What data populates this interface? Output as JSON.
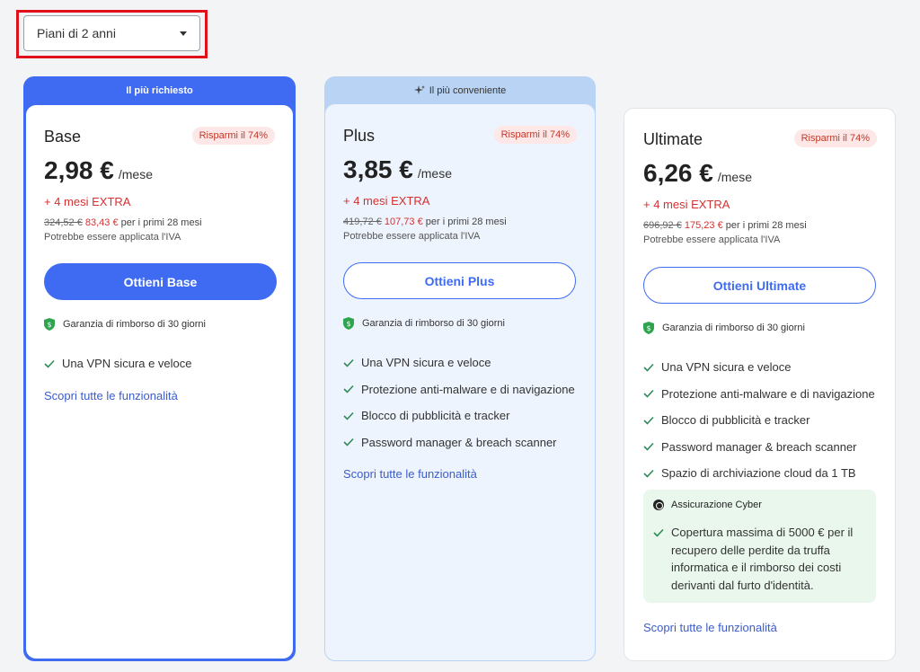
{
  "period_select": {
    "value": "Piani di 2 anni"
  },
  "plans": [
    {
      "header": "Il più richiesto",
      "name": "Base",
      "badge": "Risparmi il 74%",
      "price": "2,98 €",
      "unit": "/mese",
      "extra": "+ 4 mesi EXTRA",
      "old_total": "324,52 €",
      "new_total": "83,43 €",
      "total_suffix": "per i primi 28 mesi",
      "vat": "Potrebbe essere applicata l'IVA",
      "button": "Ottieni Base",
      "guarantee": "Garanzia di rimborso di 30 giorni",
      "features": [
        "Una VPN sicura e veloce"
      ],
      "link": "Scopri tutte le funzionalità"
    },
    {
      "header": "Il più conveniente",
      "name": "Plus",
      "badge": "Risparmi il 74%",
      "price": "3,85 €",
      "unit": "/mese",
      "extra": "+ 4 mesi EXTRA",
      "old_total": "419,72 €",
      "new_total": "107,73 €",
      "total_suffix": "per i primi 28 mesi",
      "vat": "Potrebbe essere applicata l'IVA",
      "button": "Ottieni Plus",
      "guarantee": "Garanzia di rimborso di 30 giorni",
      "features": [
        "Una VPN sicura e veloce",
        "Protezione anti-malware e di navigazione",
        "Blocco di pubblicità e tracker",
        "Password manager & breach scanner"
      ],
      "link": "Scopri tutte le funzionalità"
    },
    {
      "name": "Ultimate",
      "badge": "Risparmi il 74%",
      "price": "6,26 €",
      "unit": "/mese",
      "extra": "+ 4 mesi EXTRA",
      "old_total": "696,92 €",
      "new_total": "175,23 €",
      "total_suffix": "per i primi 28 mesi",
      "vat": "Potrebbe essere applicata l'IVA",
      "button": "Ottieni Ultimate",
      "guarantee": "Garanzia di rimborso di 30 giorni",
      "features": [
        "Una VPN sicura e veloce",
        "Protezione anti-malware e di navigazione",
        "Blocco di pubblicità e tracker",
        "Password manager & breach scanner",
        "Spazio di archiviazione cloud da 1 TB"
      ],
      "cyber_title": "Assicurazione Cyber",
      "cyber_text": "Copertura massima di 5000 € per il recupero delle perdite da truffa informatica e il rimborso dei costi derivanti dal furto d'identità.",
      "link": "Scopri tutte le funzionalità"
    }
  ],
  "colors": {
    "primary": "#3f6bf3",
    "highlight_red": "#e1111b",
    "plus_header": "#b9d3f5",
    "cyber_bg": "#e9f7ec"
  }
}
